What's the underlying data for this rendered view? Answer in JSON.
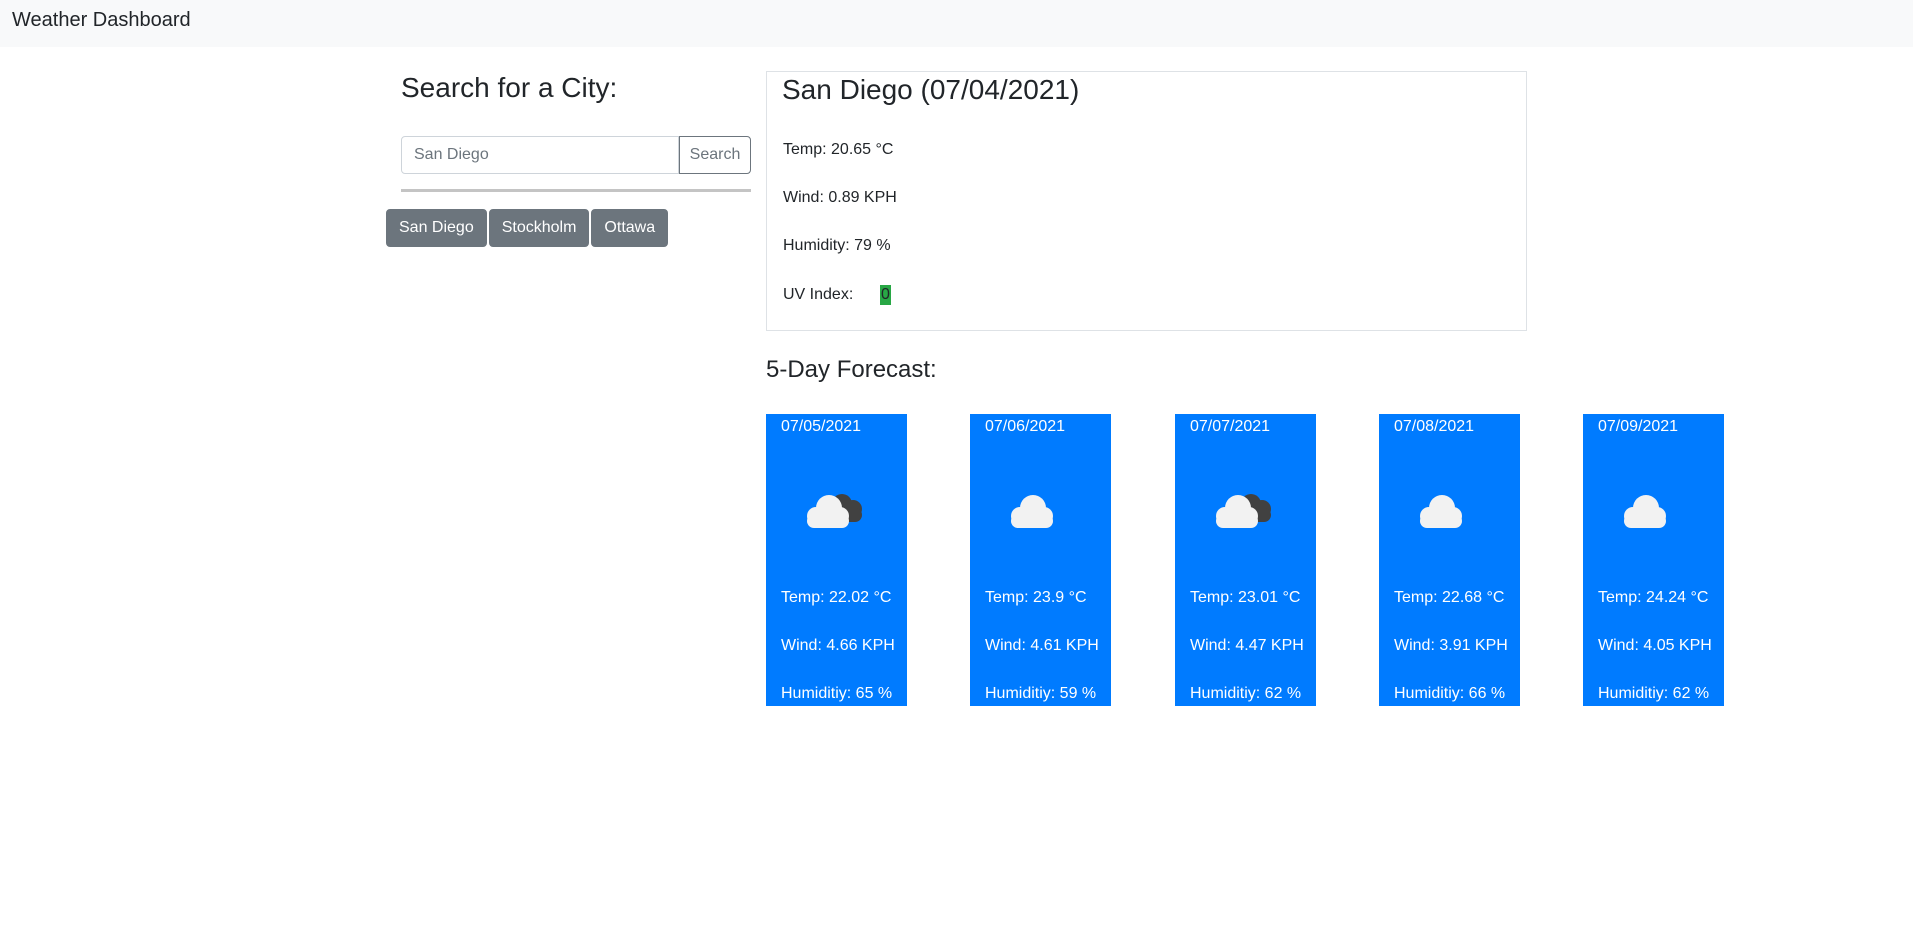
{
  "navbar": {
    "brand": "Weather Dashboard"
  },
  "search": {
    "title": "Search for a City:",
    "input_value": "",
    "placeholder": "San Diego",
    "button_label": "Search"
  },
  "history": [
    "San Diego",
    "Stockholm",
    "Ottawa"
  ],
  "current": {
    "title": "San Diego (07/04/2021)",
    "temp": "Temp: 20.65 °C",
    "wind": "Wind: 0.89 KPH",
    "humidity": "Humidity: 79 %",
    "uv_label": "UV Index:",
    "uv_value": "0",
    "uv_color": "#28a745"
  },
  "forecast": {
    "title": "5-Day Forecast:",
    "card_color": "#007bff",
    "days": [
      {
        "date": "07/05/2021",
        "icon": "broken-clouds-icon",
        "temp": "Temp: 22.02 °C",
        "wind": "Wind: 4.66 KPH",
        "humidity": "Humiditiy: 65 %"
      },
      {
        "date": "07/06/2021",
        "icon": "scattered-clouds-icon",
        "temp": "Temp: 23.9 °C",
        "wind": "Wind: 4.61 KPH",
        "humidity": "Humiditiy: 59 %"
      },
      {
        "date": "07/07/2021",
        "icon": "broken-clouds-icon",
        "temp": "Temp: 23.01 °C",
        "wind": "Wind: 4.47 KPH",
        "humidity": "Humiditiy: 62 %"
      },
      {
        "date": "07/08/2021",
        "icon": "scattered-clouds-icon",
        "temp": "Temp: 22.68 °C",
        "wind": "Wind: 3.91 KPH",
        "humidity": "Humiditiy: 66 %"
      },
      {
        "date": "07/09/2021",
        "icon": "scattered-clouds-icon",
        "temp": "Temp: 24.24 °C",
        "wind": "Wind: 4.05 KPH",
        "humidity": "Humiditiy: 62 %"
      }
    ]
  }
}
